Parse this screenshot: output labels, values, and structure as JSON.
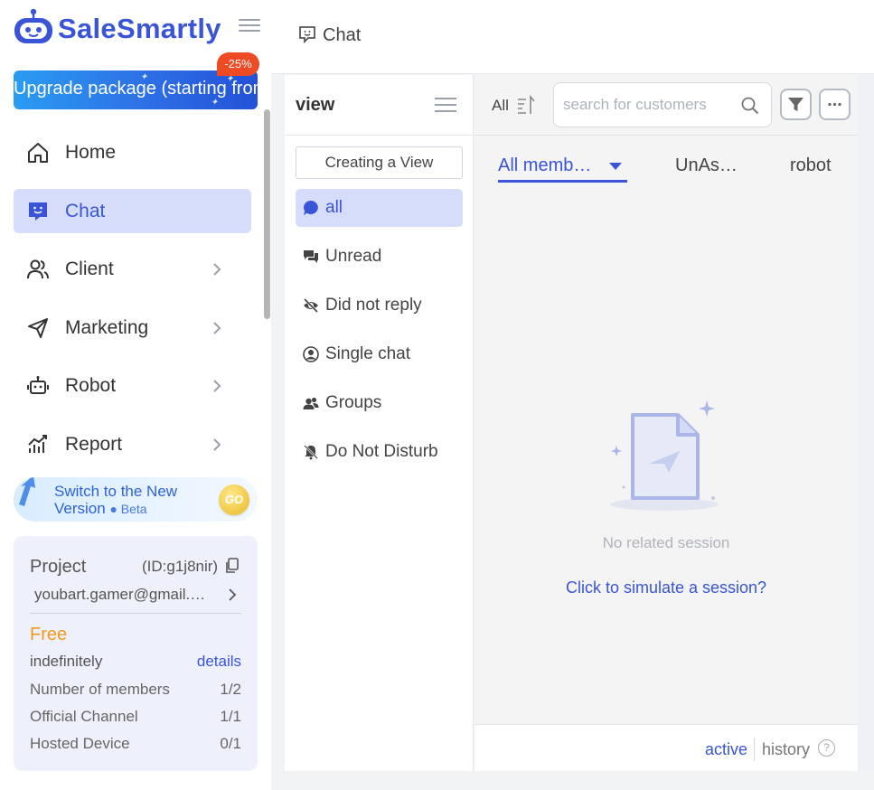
{
  "brand": {
    "name": "SaleSmartly"
  },
  "upgrade": {
    "label": "Upgrade package (starting from",
    "discount": "-25%"
  },
  "nav": [
    {
      "label": "Home",
      "icon": "home-icon",
      "active": false,
      "expandable": false
    },
    {
      "label": "Chat",
      "icon": "chat-icon",
      "active": true,
      "expandable": false
    },
    {
      "label": "Client",
      "icon": "users-icon",
      "active": false,
      "expandable": true
    },
    {
      "label": "Marketing",
      "icon": "send-icon",
      "active": false,
      "expandable": true
    },
    {
      "label": "Robot",
      "icon": "robot-icon",
      "active": false,
      "expandable": true
    },
    {
      "label": "Report",
      "icon": "chart-icon",
      "active": false,
      "expandable": true
    }
  ],
  "switch_banner": {
    "line1": "Switch to the New",
    "line2": "Version",
    "badge": "● Beta",
    "go": "GO"
  },
  "project": {
    "title": "Project",
    "id": "(ID:g1j8nir)",
    "email": "youbart.gamer@gmail.…",
    "plan": "Free",
    "term": "indefinitely",
    "details_link": "details",
    "rows": [
      {
        "label": "Number of members",
        "value": "1/2"
      },
      {
        "label": "Official Channel",
        "value": "1/1"
      },
      {
        "label": "Hosted Device",
        "value": "0/1"
      }
    ]
  },
  "header": {
    "title": "Chat"
  },
  "views": {
    "title": "view",
    "create_button": "Creating a View",
    "items": [
      {
        "label": "all",
        "icon": "chat-bubble-icon",
        "active": true
      },
      {
        "label": "Unread",
        "icon": "unread-messages-icon",
        "active": false
      },
      {
        "label": "Did not reply",
        "icon": "eye-off-icon",
        "active": false
      },
      {
        "label": "Single chat",
        "icon": "user-circle-icon",
        "active": false
      },
      {
        "label": "Groups",
        "icon": "group-icon",
        "active": false
      },
      {
        "label": "Do Not Disturb",
        "icon": "bell-off-icon",
        "active": false
      }
    ]
  },
  "conversations": {
    "filter_all": "All",
    "search_placeholder": "search for customers",
    "tabs": [
      {
        "label": "All memb…",
        "active": true
      },
      {
        "label": "UnAs…",
        "active": false
      },
      {
        "label": "robot",
        "active": false
      }
    ],
    "empty_text": "No related session",
    "simulate_link": "Click to simulate a session?",
    "bottom": {
      "active": "active",
      "history": "history",
      "help": "?"
    }
  },
  "colors": {
    "accent": "#3a54d8",
    "active_bg": "#d6ddfa",
    "plan_free": "#f29a1c",
    "discount": "#ee4a23"
  }
}
